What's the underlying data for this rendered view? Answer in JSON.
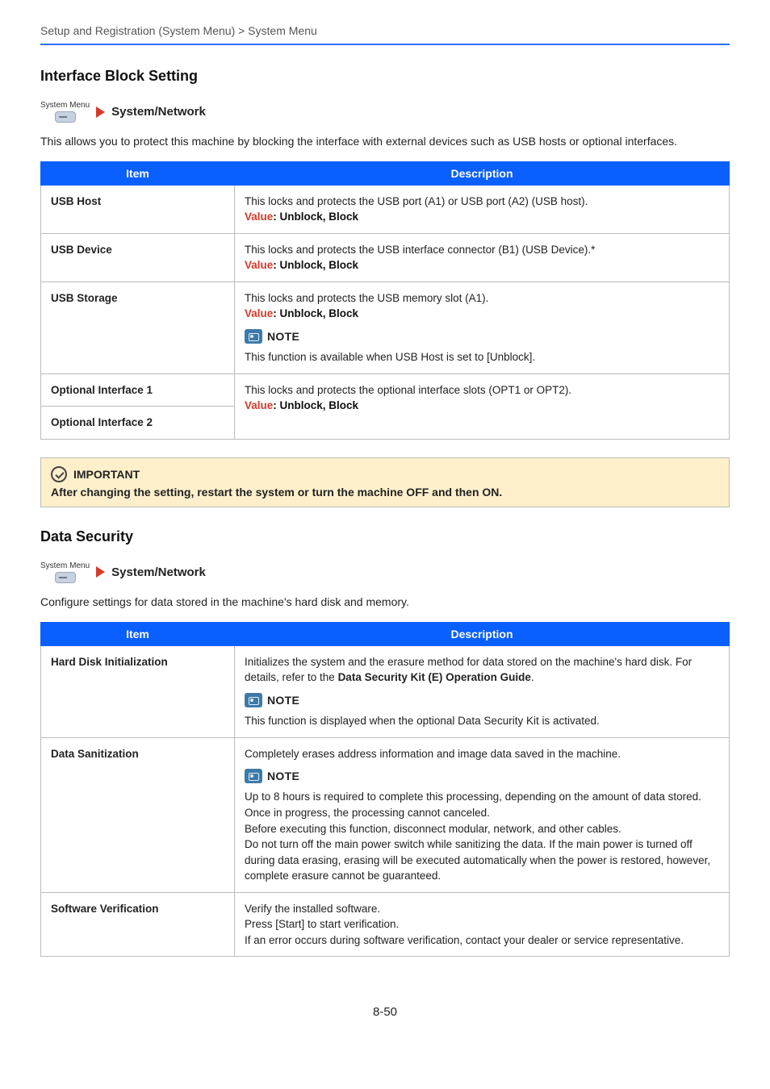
{
  "header": {
    "breadcrumb": "Setup and Registration (System Menu) > System Menu"
  },
  "system_menu_label": "System Menu",
  "sections": {
    "interface_block": {
      "title": "Interface Block Setting",
      "nav": "System/Network",
      "intro": "This allows you to protect this machine by blocking the interface with external devices such as USB hosts or optional interfaces.",
      "table_headers": {
        "item": "Item",
        "desc": "Description"
      },
      "value_label": "Value",
      "value_options": "Unblock, Block",
      "rows": {
        "usb_host": {
          "name": "USB Host",
          "desc": "This locks and protects the USB port (A1) or USB port (A2) (USB host)."
        },
        "usb_device": {
          "name": "USB Device",
          "desc": "This locks and protects the USB interface connector (B1) (USB Device).*"
        },
        "usb_storage": {
          "name": "USB Storage",
          "desc": "This locks and protects the USB memory slot (A1).",
          "note_label": "NOTE",
          "note_body": "This function is available when USB Host is set to [Unblock]."
        },
        "opt1": {
          "name": "Optional Interface 1"
        },
        "opt2": {
          "name": "Optional Interface 2"
        },
        "opt_desc": "This locks and protects the optional interface slots (OPT1 or OPT2)."
      },
      "important": {
        "label": "IMPORTANT",
        "body": "After changing the setting, restart the system or turn the machine OFF and then ON."
      }
    },
    "data_security": {
      "title": "Data Security",
      "nav": "System/Network",
      "intro": "Configure settings for data stored in the machine's hard disk and memory.",
      "table_headers": {
        "item": "Item",
        "desc": "Description"
      },
      "rows": {
        "hdi": {
          "name": "Hard Disk Initialization",
          "desc_pre": "Initializes the system and the erasure method for data stored on the machine's hard disk. For details, refer to the ",
          "desc_bold": "Data Security Kit (E) Operation Guide",
          "desc_post": ".",
          "note_label": "NOTE",
          "note_body": "This function is displayed when the optional Data Security Kit is activated."
        },
        "sanit": {
          "name": "Data Sanitization",
          "desc_top": "Completely erases address information and image data saved in the machine.",
          "note_label": "NOTE",
          "note_lines": {
            "l1": "Up to 8 hours is required to complete this processing, depending on the amount of data stored.",
            "l2": "Once in progress, the processing cannot canceled.",
            "l3": "Before executing this function, disconnect modular, network, and other cables.",
            "l4": "Do not turn off the main power switch while sanitizing the data. If the main power is turned off during data erasing, erasing will be executed automatically when the power is restored, however, complete erasure cannot be guaranteed."
          }
        },
        "softver": {
          "name": "Software Verification",
          "l1": "Verify the installed software.",
          "l2": "Press [Start] to start verification.",
          "l3": "If an error occurs during software verification, contact your dealer or service representative."
        }
      }
    }
  },
  "footer": "8-50"
}
